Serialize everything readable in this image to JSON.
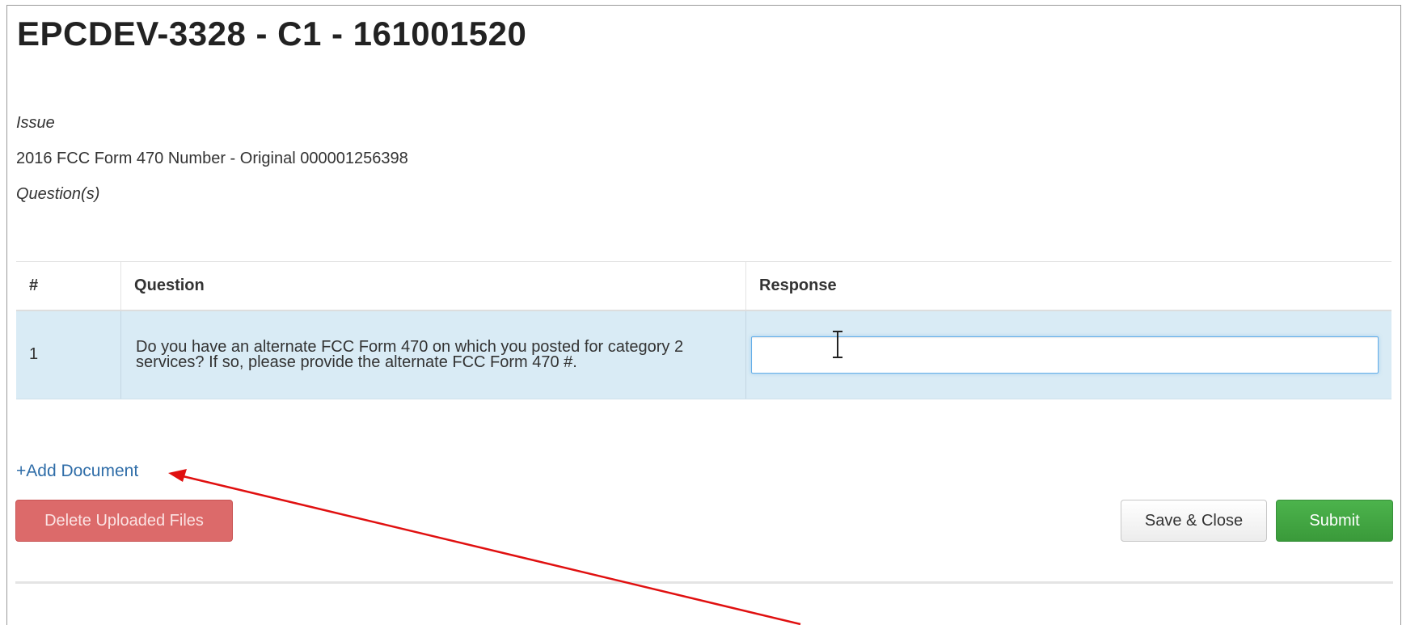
{
  "page": {
    "title": "EPCDEV-3328 - C1 - 161001520",
    "issue_label": "Issue",
    "issue_text": "2016 FCC Form 470 Number - Original 000001256398",
    "questions_label": "Question(s)"
  },
  "table": {
    "headers": [
      "#",
      "Question",
      "Response"
    ],
    "rows": [
      {
        "num": "1",
        "question": "Do you have an alternate FCC Form 470 on which you posted for category 2 services? If so, please provide the alternate FCC Form 470 #.",
        "response": ""
      }
    ]
  },
  "actions": {
    "add_document": "+Add Document",
    "delete_files": "Delete Uploaded Files",
    "save_close": "Save & Close",
    "submit": "Submit"
  },
  "colors": {
    "delete": "#dc6a6a",
    "submit": "#3fa33f",
    "link": "#2f6da8",
    "row_highlight": "#d9ebf5",
    "annotation_arrow": "#e01010"
  },
  "icons": {
    "text_cursor": "i-beam-cursor-icon",
    "annotation": "red-arrow-icon"
  }
}
